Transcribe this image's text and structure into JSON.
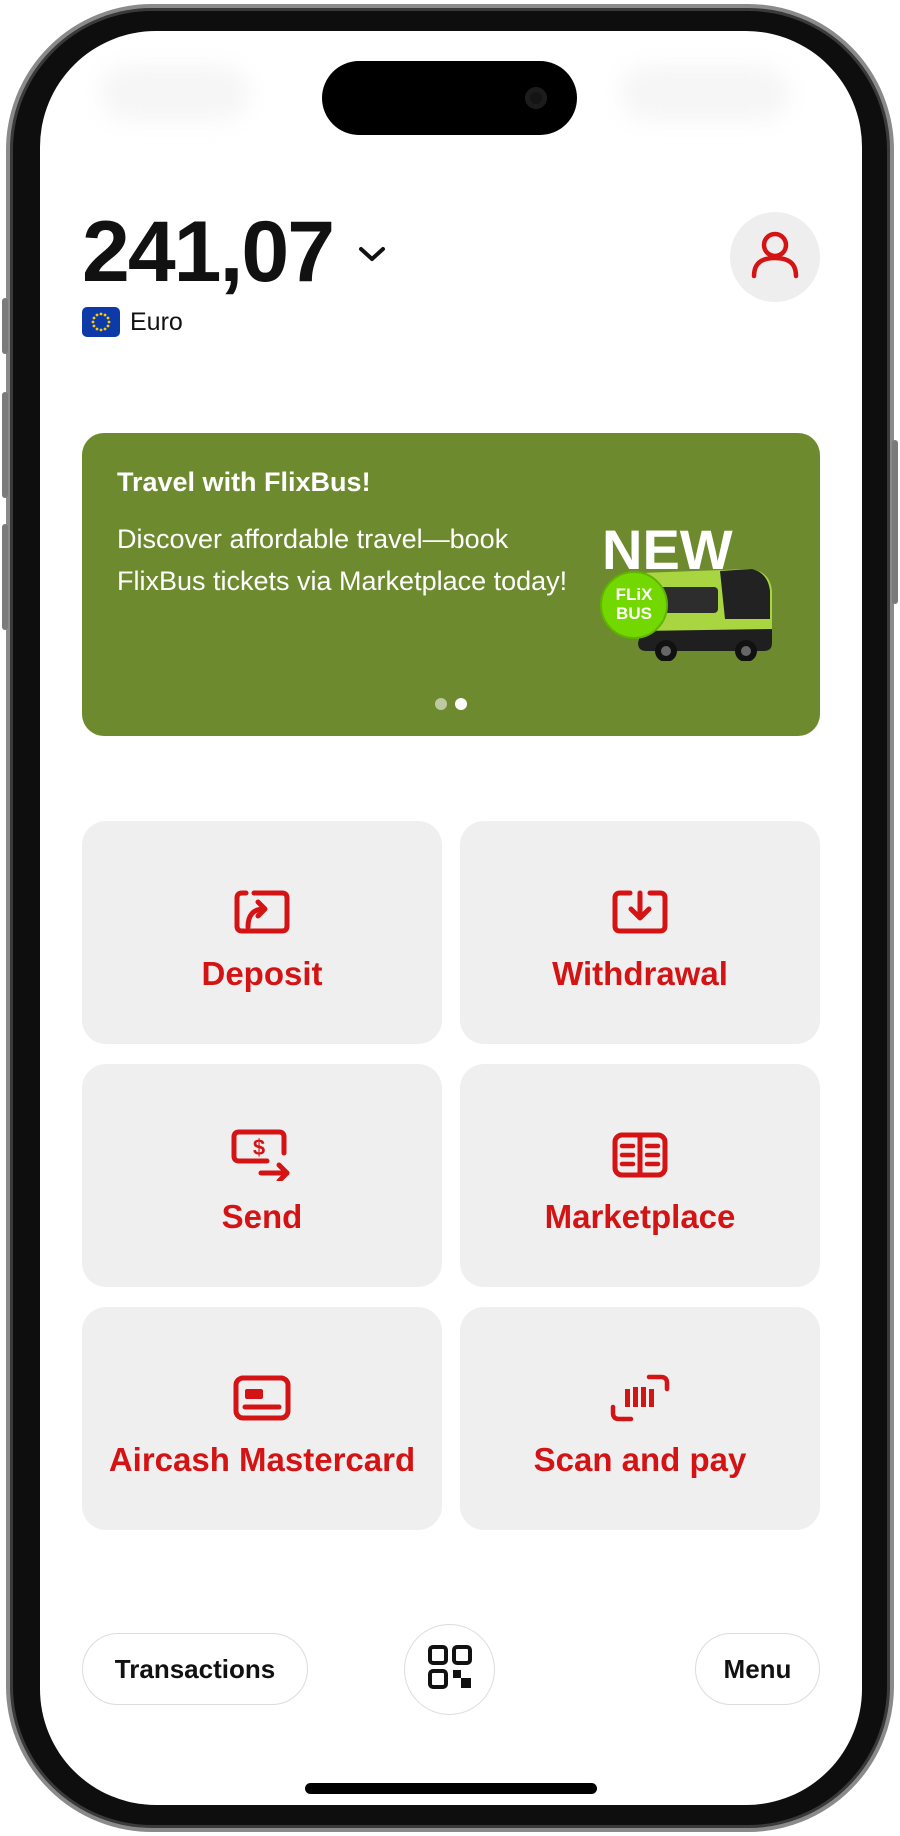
{
  "balance": {
    "amount": "241,07",
    "currency": "Euro"
  },
  "banner": {
    "title": "Travel with FlixBus!",
    "body": "Discover affordable travel—book FlixBus tickets via Marketplace today!",
    "art_new_text": "NEW",
    "art_brand_line1": "FLiX",
    "art_brand_line2": "BUS",
    "page_count": 2,
    "active_page": 2
  },
  "actions": [
    {
      "label": "Deposit",
      "icon": "deposit-icon"
    },
    {
      "label": "Withdrawal",
      "icon": "withdrawal-icon"
    },
    {
      "label": "Send",
      "icon": "send-money-icon"
    },
    {
      "label": "Marketplace",
      "icon": "marketplace-icon"
    },
    {
      "label": "Aircash Mastercard",
      "icon": "card-icon"
    },
    {
      "label": "Scan and pay",
      "icon": "barcode-scan-icon"
    }
  ],
  "bottom_bar": {
    "transactions_label": "Transactions",
    "menu_label": "Menu"
  },
  "colors": {
    "accent_red": "#d41414",
    "banner_green": "#6e8a2f",
    "tile_bg": "#efeff0",
    "flixbus_green": "#73d700"
  }
}
